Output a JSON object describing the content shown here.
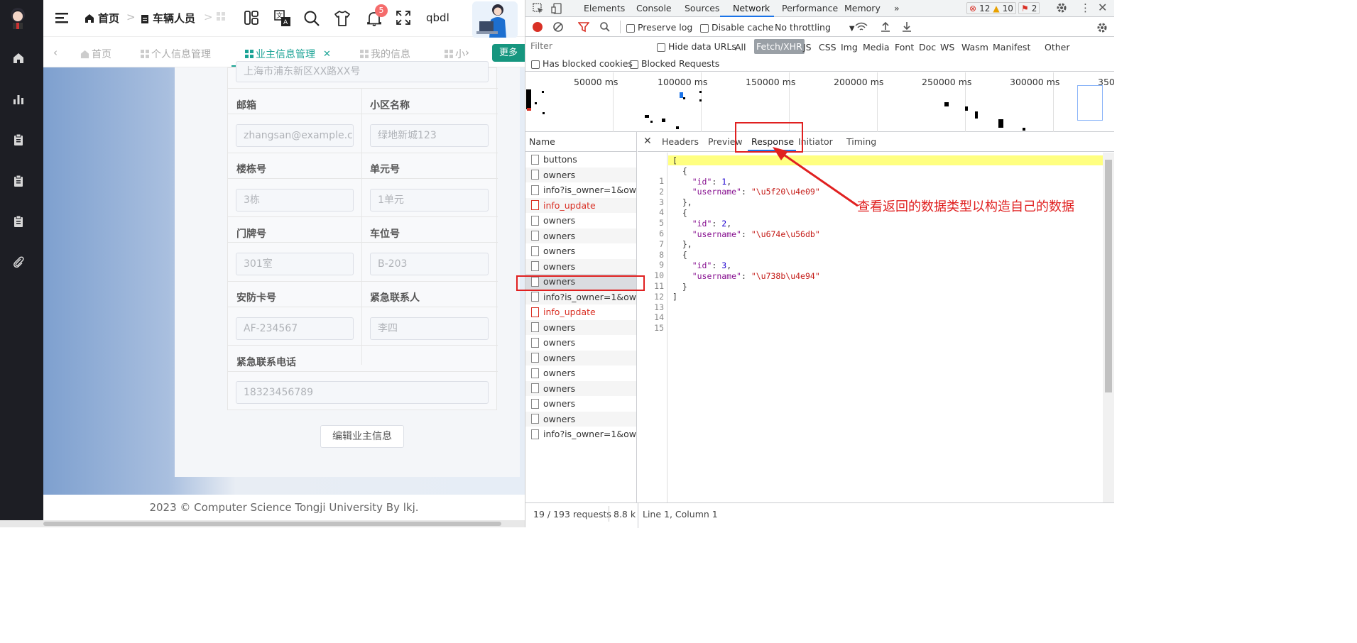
{
  "app": {
    "breadcrumb": [
      "首页",
      "车辆人员"
    ],
    "user": "qbdl",
    "notify_count": "5",
    "tabs": [
      "首页",
      "个人信息管理",
      "业主信息管理",
      "我的信息",
      "小"
    ],
    "more_label": "更多",
    "address_partial": "上海市浦东新区XX路XX号",
    "form": {
      "email_label": "邮箱",
      "email_value": "zhangsan@example.c",
      "community_label": "小区名称",
      "community_value": "绿地新城123",
      "building_label": "楼栋号",
      "building_value": "3栋",
      "unit_label": "单元号",
      "unit_value": "1单元",
      "door_label": "门牌号",
      "door_value": "301室",
      "parking_label": "车位号",
      "parking_value": "B-203",
      "security_label": "安防卡号",
      "security_value": "AF-234567",
      "contact_label": "紧急联系人",
      "contact_value": "李四",
      "phone_label": "紧急联系电话",
      "phone_value": "18323456789"
    },
    "edit_button": "编辑业主信息",
    "footer": "2023 © Computer Science Tongji University By lkj."
  },
  "devtools": {
    "tabs": [
      "Elements",
      "Console",
      "Sources",
      "Network",
      "Performance",
      "Memory"
    ],
    "errors": "12",
    "warnings": "10",
    "issues": "2",
    "preserve_log": "Preserve log",
    "disable_cache": "Disable cache",
    "throttle": "No throttling",
    "filter_placeholder": "Filter",
    "hide_data_urls": "Hide data URLs",
    "filters": [
      "All",
      "Fetch/XHR",
      "JS",
      "CSS",
      "Img",
      "Media",
      "Font",
      "Doc",
      "WS",
      "Wasm",
      "Manifest",
      "Other"
    ],
    "has_blocked_cookies": "Has blocked cookies",
    "blocked_requests": "Blocked Requests",
    "timeline_labels": [
      "50000 ms",
      "100000 ms",
      "150000 ms",
      "200000 ms",
      "250000 ms",
      "300000 ms",
      "350"
    ],
    "name_header": "Name",
    "requests": [
      "buttons",
      "owners",
      "info?is_owner=1&ow...",
      "info_update",
      "owners",
      "owners",
      "owners",
      "owners",
      "owners",
      "info?is_owner=1&ow...",
      "info_update",
      "owners",
      "owners",
      "owners",
      "owners",
      "owners",
      "owners",
      "owners",
      "info?is_owner=1&ow..."
    ],
    "detail_tabs": [
      "Headers",
      "Preview",
      "Response",
      "Initiator",
      "Timing"
    ],
    "status_requests": "19 / 193 requests",
    "status_size": "8.8 kB",
    "cursor_pos": "Line 1, Column 1",
    "response_lines": [
      "[",
      "  {",
      "    \"id\": 1,",
      "    \"username\": \"\\u5f20\\u4e09\"",
      "  },",
      "  {",
      "    \"id\": 2,",
      "    \"username\": \"\\u674e\\u56db\"",
      "  },",
      "  {",
      "    \"id\": 3,",
      "    \"username\": \"\\u738b\\u4e94\"",
      "  }",
      "]",
      ""
    ]
  },
  "annotation": "查看返回的数据类型以构造自己的数据",
  "colors": {
    "sidebar": "#1d1e24",
    "accent": "#16967f",
    "annotation": "#e02020",
    "devtools_blue": "#1a73e8"
  }
}
